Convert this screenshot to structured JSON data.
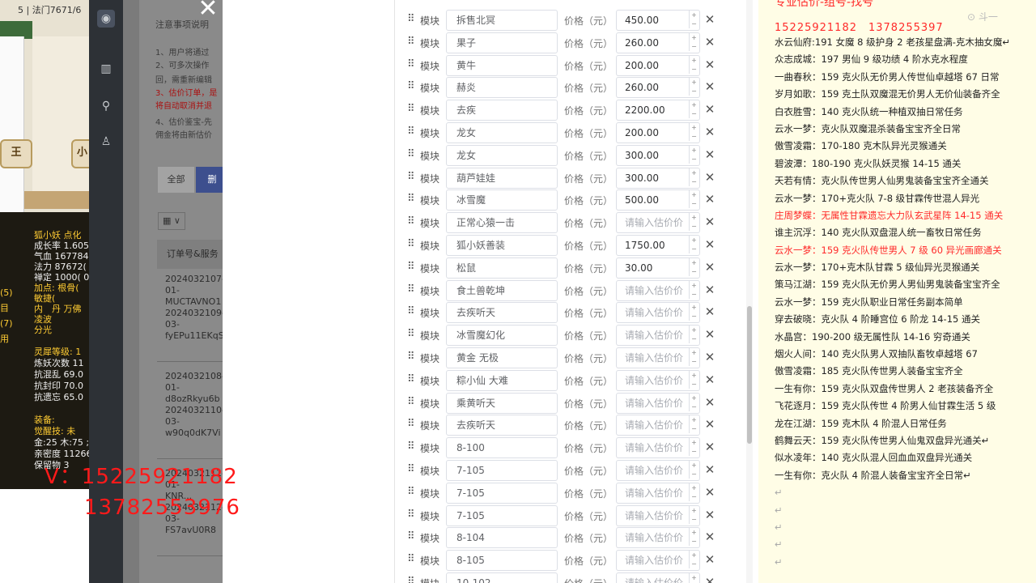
{
  "game": {
    "title": "5 | 法门7671/6",
    "button_left": "王",
    "button_right": "小",
    "stats": [
      "狐小妖 点化",
      "成长率 1.605",
      "气血 167784",
      "法力 87672(",
      "禅定 1000( 0",
      "加点: 根骨(",
      "敏捷(",
      "内　丹 万佛",
      "凌波",
      "分光"
    ],
    "left_list": [
      "(5)",
      "目",
      "(7)",
      "用"
    ],
    "lower": [
      "灵犀等级: 1",
      "炼妖次数 11",
      "抗混乱 69.0",
      "抗封印 70.0",
      "抗遗忘 65.0",
      "",
      "装备:",
      "觉醒技: 未",
      "金:25 木:75 ;",
      "亲密度 11266",
      "保留物 3"
    ]
  },
  "sidebar": {
    "icons": [
      "app-logo-icon",
      "building-icon",
      "search-icon",
      "user-icon"
    ]
  },
  "overlay": {
    "notice_title": "注意事项说明",
    "notes": [
      {
        "text": "1、用户将通过",
        "red": false
      },
      {
        "text": "2、可多次操作",
        "red": false
      },
      {
        "text": "回，需重新编辑",
        "red": false
      },
      {
        "text": "3、估价订单，是",
        "red": true
      },
      {
        "text": "将自动取消并退",
        "red": true
      },
      {
        "text": "4、估价鉴宝-先",
        "red": false
      },
      {
        "text": "佣金将由新估价",
        "red": false
      }
    ],
    "tab_all": "全部",
    "tab_active": "删",
    "grid_select": "▦ ∨",
    "column_header": "订单号&服务",
    "orders": [
      [
        "2024032107-",
        "01-",
        "MUCTAVNO1",
        "2024032109-",
        "03-",
        "fyEPu11EKqS"
      ],
      [
        "2024032108-",
        "01-",
        "d8ozRkyu6b",
        "2024032110-",
        "03-",
        "w90q0dK7Vi"
      ],
      [
        "2024032111-",
        "01-",
        "KNR...",
        "2024032112-",
        "03-",
        "FS7avU0R8"
      ]
    ]
  },
  "valuation": {
    "module_label": "模块",
    "price_label": "价格（元）",
    "price_placeholder": "请输入估价价",
    "rows": [
      {
        "name": "拆售北冥",
        "price": "450.00"
      },
      {
        "name": "果子",
        "price": "260.00"
      },
      {
        "name": "黄牛",
        "price": "200.00"
      },
      {
        "name": "赫炎",
        "price": "260.00"
      },
      {
        "name": "去疾",
        "price": "2200.00"
      },
      {
        "name": "龙女",
        "price": "200.00"
      },
      {
        "name": "龙女",
        "price": "300.00"
      },
      {
        "name": "葫芦娃娃",
        "price": "300.00"
      },
      {
        "name": "冰雪魔",
        "price": "500.00"
      },
      {
        "name": "正常心猿一击",
        "price": ""
      },
      {
        "name": "狐小妖善装",
        "price": "1750.00"
      },
      {
        "name": "松鼠",
        "price": "30.00"
      },
      {
        "name": "食土兽乾坤",
        "price": ""
      },
      {
        "name": "去疾听天",
        "price": ""
      },
      {
        "name": "冰雪魔幻化",
        "price": ""
      },
      {
        "name": "黄金 无极",
        "price": ""
      },
      {
        "name": "粽小仙 大难",
        "price": ""
      },
      {
        "name": "乘黄听天",
        "price": ""
      },
      {
        "name": "去疾听天",
        "price": ""
      },
      {
        "name": "8-100",
        "price": ""
      },
      {
        "name": "7-105",
        "price": ""
      },
      {
        "name": "7-105",
        "price": ""
      },
      {
        "name": "7-105",
        "price": ""
      },
      {
        "name": "8-104",
        "price": ""
      },
      {
        "name": "8-105",
        "price": ""
      },
      {
        "name": "10-102",
        "price": ""
      }
    ]
  },
  "watermark": {
    "line1": "V：15225921182",
    "line2": "13782553976"
  },
  "notepad": {
    "header": "专业估价-组号-找号",
    "phones": "15225921182　1378255397",
    "corner": "⊙ 斗一",
    "lines": [
      {
        "text": "水云仙府:191 女魔 8 级护身 2 老孩星盘满-克木抽女魔↵",
        "red": false
      },
      {
        "text": "众志成城：197 男仙 9 级功绩 4 阶水克水程度",
        "red": false
      },
      {
        "text": "一曲春秋：159 克火队无价男人传世仙卓越塔 67 日常",
        "red": false
      },
      {
        "text": "岁月如歌：159 克土队双魔混无价男人无价仙装备齐全",
        "red": false
      },
      {
        "text": "白衣胜雪：140 克火队统一种植双抽日常任务",
        "red": false
      },
      {
        "text": "云水一梦：克火队双魔混杀装备宝宝齐全日常",
        "red": false
      },
      {
        "text": "傲雪凌霜：170-180 克木队异光灵猴通关",
        "red": false
      },
      {
        "text": "碧波潭：180-190 克火队妖灵猴 14-15 通关",
        "red": false
      },
      {
        "text": "天若有情：克火队传世男人仙男鬼装备宝宝齐全通关",
        "red": false
      },
      {
        "text": "云水一梦：170+克火队 7-8 级甘霖传世混人异光",
        "red": false
      },
      {
        "text": "庄周梦蝶：无属性甘霖遗忘大力队玄武星阵 14-15 通关",
        "red": true
      },
      {
        "text": "谁主沉浮：140 克火队双盘混人统一畜牧日常任务",
        "red": false
      },
      {
        "text": "云水一梦：159 克火队传世男人 7 级 60 异光画廊通关",
        "red": true
      },
      {
        "text": "云水一梦：170+克木队甘霖 5 级仙异光灵猴通关",
        "red": false
      },
      {
        "text": "策马江湖：159 克火队无价男人男仙男鬼装备宝宝齐全",
        "red": false
      },
      {
        "text": "云水一梦：159 克火队职业日常任务副本简单",
        "red": false
      },
      {
        "text": "穿去破晓：克火队 4 阶睡宫位 6 阶龙 14-15 通关",
        "red": false
      },
      {
        "text": "水晶宫：190-200 级无属性队 14-16 穷奇通关",
        "red": false
      },
      {
        "text": "烟火人间：140 克火队男人双抽队畜牧卓越塔 67",
        "red": false
      },
      {
        "text": "傲雪凌霜：185 克火队传世男人装备宝宝齐全",
        "red": false
      },
      {
        "text": "一生有你：159 克火队双盘传世男人 2 老孩装备齐全",
        "red": false
      },
      {
        "text": "飞花逐月：159 克火队传世 4 阶男人仙甘霖生活 5 级",
        "red": false
      },
      {
        "text": "龙在江湖：159 克木队 4 阶混人日常任务",
        "red": false
      },
      {
        "text": "鹤舞云天：159 克火队传世男人仙鬼双盘异光通关↵",
        "red": false
      },
      {
        "text": "似水凌年：140 克火队混人回血血双盘异光通关",
        "red": false
      },
      {
        "text": "一生有你：克火队 4 阶混人装备宝宝齐全日常↵",
        "red": false
      },
      {
        "text": "↵",
        "red": false
      },
      {
        "text": "↵",
        "red": false
      },
      {
        "text": "↵",
        "red": false
      },
      {
        "text": "↵",
        "red": false
      },
      {
        "text": "↵",
        "red": false
      }
    ]
  },
  "colors": {
    "accent_red": "#ff2a2a",
    "notepad_bg": "#fffde6",
    "sidebar_dark": "#2d3136",
    "active_tab": "#3d4f8e"
  }
}
